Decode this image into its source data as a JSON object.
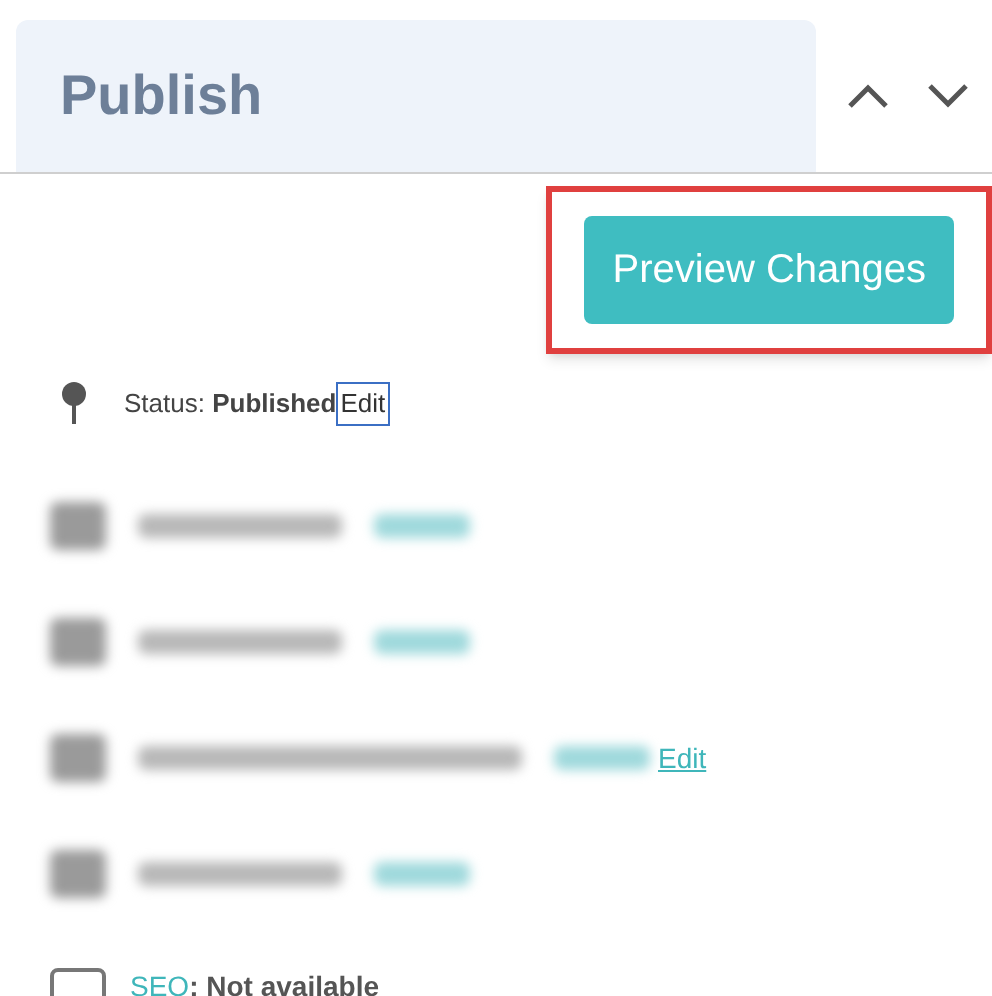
{
  "panel": {
    "title": "Publish"
  },
  "preview_button": {
    "label": "Preview Changes",
    "highlighted": true
  },
  "status": {
    "label": "Status: ",
    "value": "Published",
    "link": "Edit"
  },
  "rows": [
    {
      "kind": "blurred"
    },
    {
      "kind": "blurred"
    },
    {
      "kind": "blurred_with_link",
      "link": "Edit"
    },
    {
      "kind": "blurred"
    },
    {
      "kind": "seo",
      "link": "SEO",
      "text": ": Not available"
    }
  ]
}
